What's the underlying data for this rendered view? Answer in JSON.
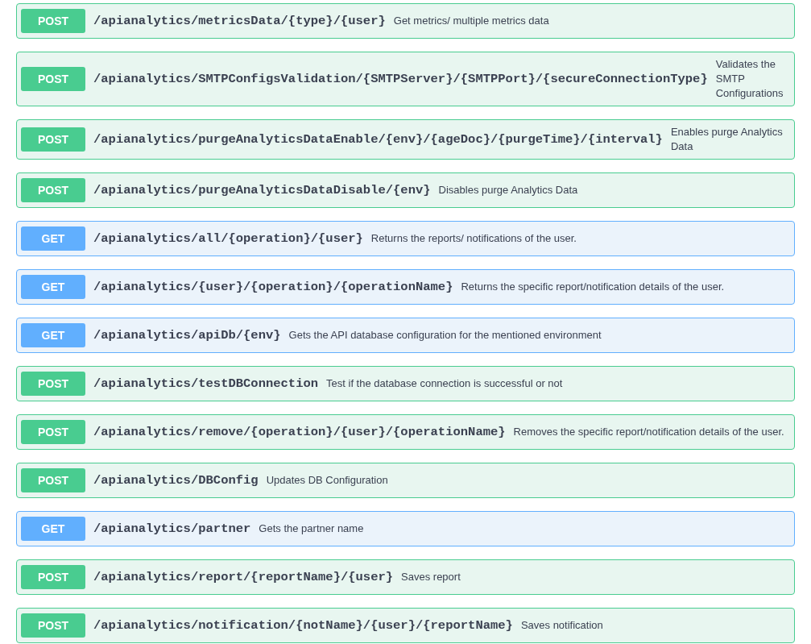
{
  "operations": [
    {
      "method": "POST",
      "path": "/apianalytics/metricsData/{type}/{user}",
      "description": "Get metrics/ multiple metrics data"
    },
    {
      "method": "POST",
      "path": "/apianalytics/SMTPConfigsValidation/{SMTPServer}/{SMTPPort}/{secureConnectionType}",
      "description": "Validates the SMTP Configurations"
    },
    {
      "method": "POST",
      "path": "/apianalytics/purgeAnalyticsDataEnable/{env}/{ageDoc}/{purgeTime}/{interval}",
      "description": "Enables purge Analytics Data"
    },
    {
      "method": "POST",
      "path": "/apianalytics/purgeAnalyticsDataDisable/{env}",
      "description": "Disables purge Analytics Data"
    },
    {
      "method": "GET",
      "path": "/apianalytics/all/{operation}/{user}",
      "description": "Returns the reports/ notifications of the user."
    },
    {
      "method": "GET",
      "path": "/apianalytics/{user}/{operation}/{operationName}",
      "description": "Returns the specific report/notification details of the user."
    },
    {
      "method": "GET",
      "path": "/apianalytics/apiDb/{env}",
      "description": "Gets the API database configuration for the mentioned environment"
    },
    {
      "method": "POST",
      "path": "/apianalytics/testDBConnection",
      "description": "Test if the database connection is successful or not"
    },
    {
      "method": "POST",
      "path": "/apianalytics/remove/{operation}/{user}/{operationName}",
      "description": "Removes the specific report/notification details of the user."
    },
    {
      "method": "POST",
      "path": "/apianalytics/DBConfig",
      "description": "Updates DB Configuration"
    },
    {
      "method": "GET",
      "path": "/apianalytics/partner",
      "description": "Gets the partner name"
    },
    {
      "method": "POST",
      "path": "/apianalytics/report/{reportName}/{user}",
      "description": "Saves report"
    },
    {
      "method": "POST",
      "path": "/apianalytics/notification/{notName}/{user}/{reportName}",
      "description": "Saves notification"
    }
  ]
}
